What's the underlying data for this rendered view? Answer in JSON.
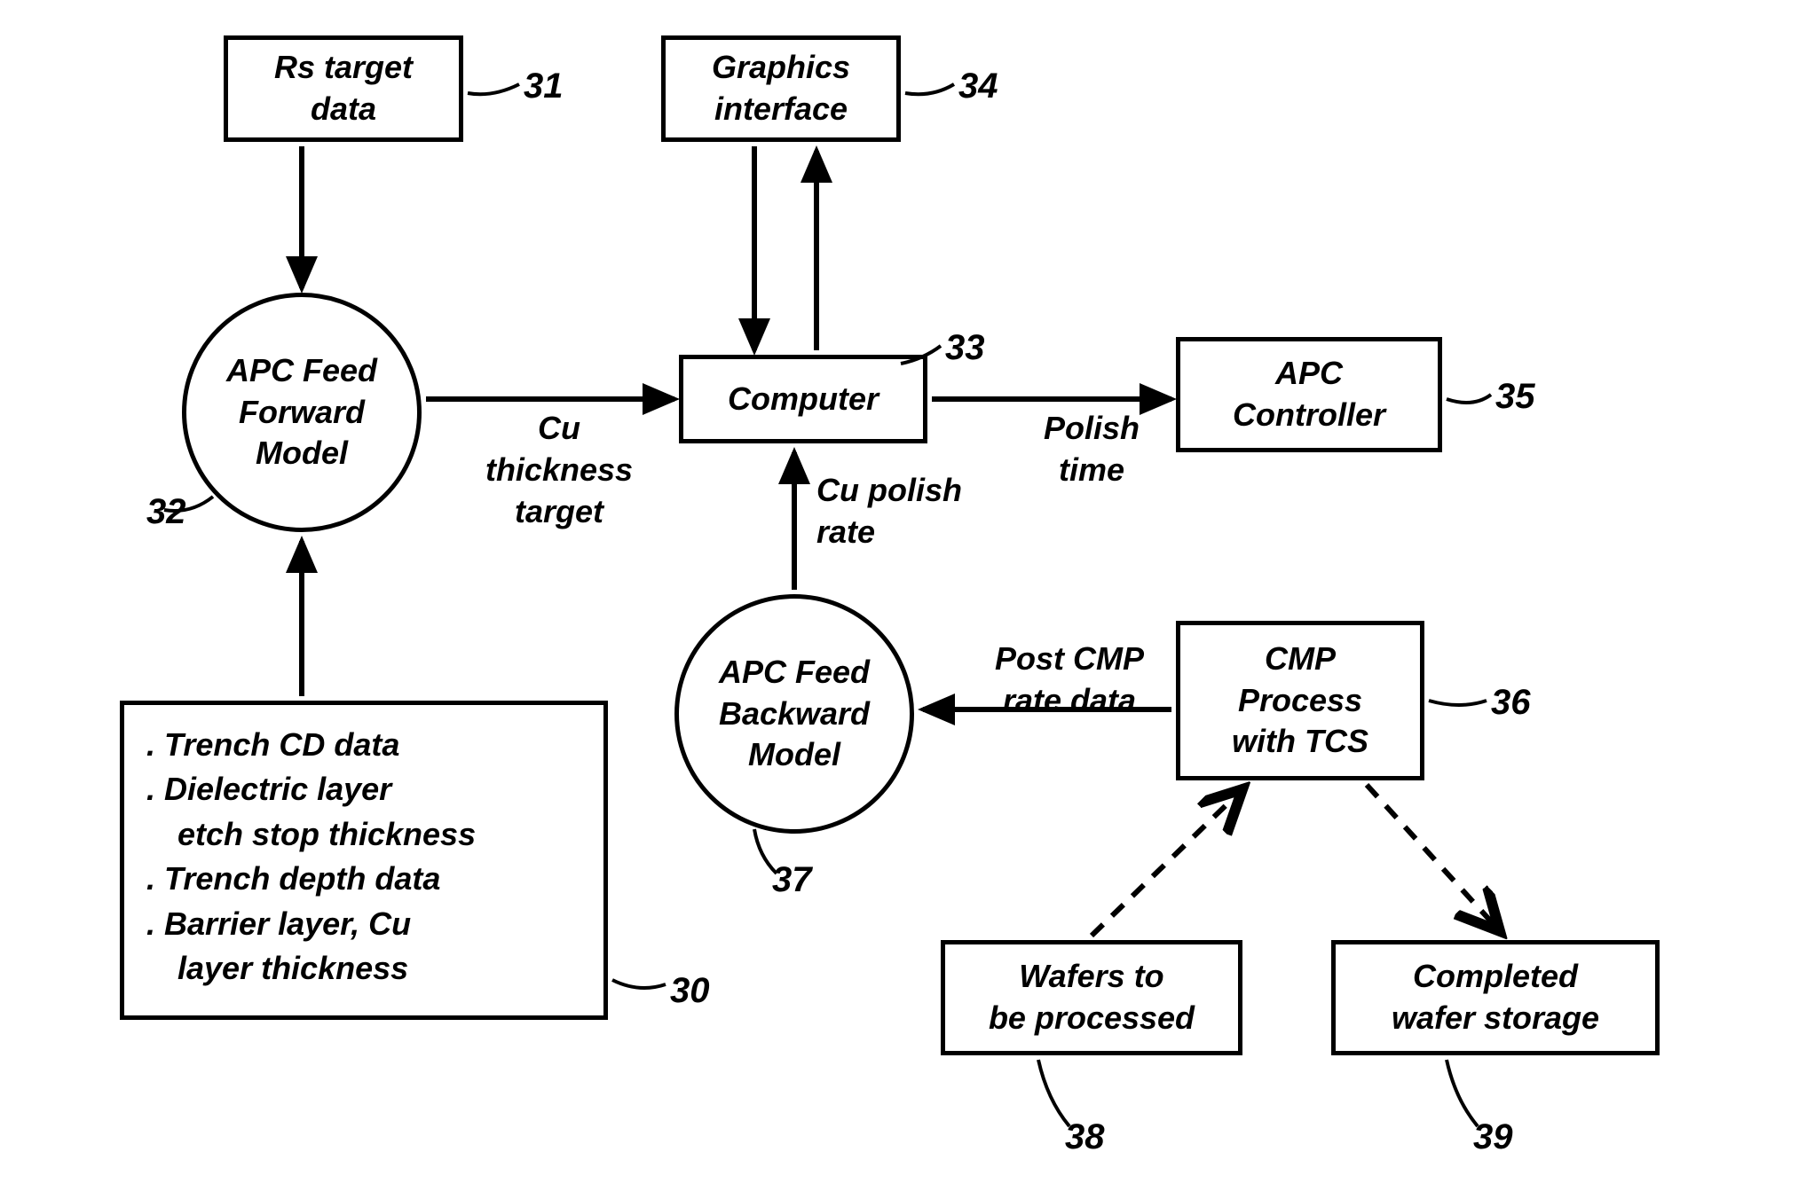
{
  "blocks": {
    "rs_target": "Rs target\ndata",
    "graphics_interface": "Graphics\ninterface",
    "computer": "Computer",
    "apc_controller": "APC\nController",
    "feed_forward": "APC Feed\nForward\nModel",
    "feed_backward": "APC Feed\nBackward\nModel",
    "cmp_process": "CMP\nProcess\nwith TCS",
    "wafers_process": "Wafers to\nbe processed",
    "completed_storage": "Completed\nwafer storage",
    "input_list": {
      "i1": ". Trench CD data",
      "i2a": ". Dielectric layer",
      "i2b": "etch stop thickness",
      "i3": ". Trench depth data",
      "i4a": ". Barrier layer, Cu",
      "i4b": "layer thickness"
    }
  },
  "edge_labels": {
    "cu_thickness": "Cu\nthickness\ntarget",
    "polish_time": "Polish\ntime",
    "cu_polish_rate": "Cu polish\nrate",
    "post_cmp_rate": "Post CMP\nrate data"
  },
  "nums": {
    "n30": "30",
    "n31": "31",
    "n32": "32",
    "n33": "33",
    "n34": "34",
    "n35": "35",
    "n36": "36",
    "n37": "37",
    "n38": "38",
    "n39": "39"
  }
}
